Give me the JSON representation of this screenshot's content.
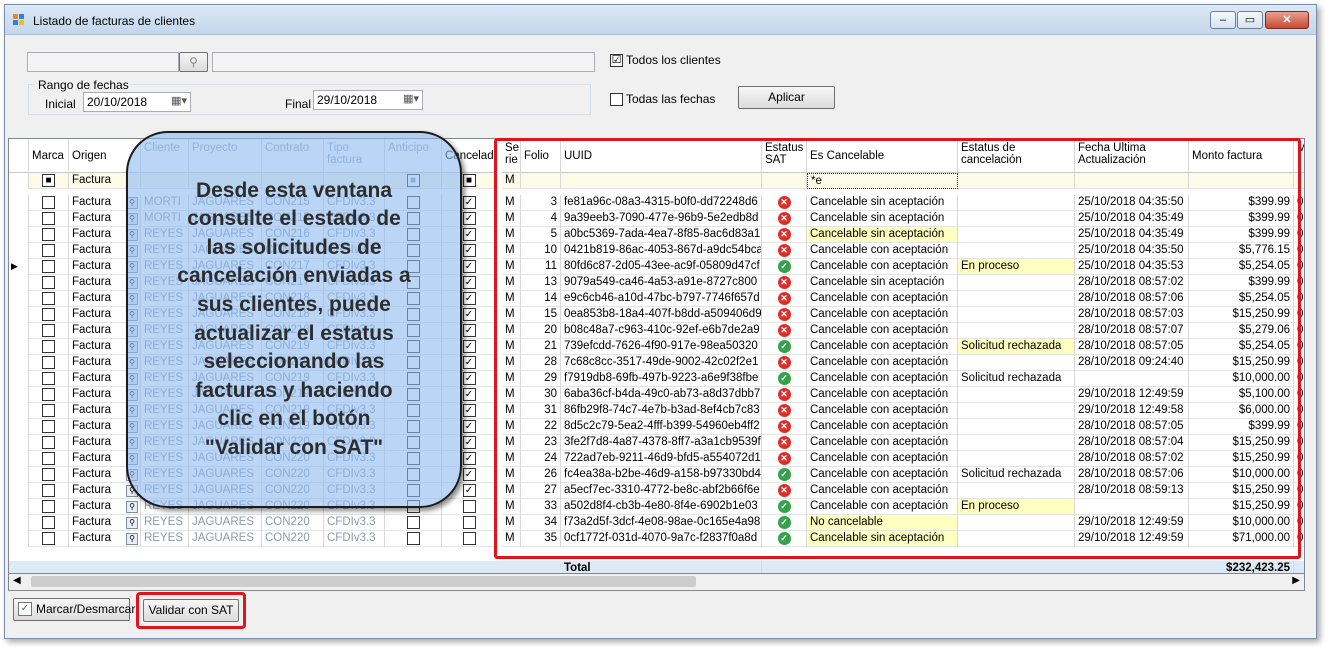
{
  "window": {
    "title": "Listado de facturas de clientes",
    "btn_min": "‒",
    "btn_max": "▭",
    "btn_close": "✕",
    "brand_colors": {
      "titlebar": "#c4d6ec",
      "red_highlight": "#e0141a",
      "callout": "#8cb9f0"
    }
  },
  "filters": {
    "client_code_value": "",
    "client_name_value": "",
    "lookup_icon": "binoculars-icon",
    "todos_clientes_label": "Todos los clientes",
    "todos_clientes_checked": "☑",
    "rango_label": "Rango de fechas",
    "inicial_label": "Inicial",
    "inicial_value": "20/10/2018",
    "final_label": "Final",
    "final_value": "29/10/2018",
    "calendar_icon": "calendar-icon",
    "todas_fechas_label": "Todas las fechas",
    "aplicar_label": "Aplicar"
  },
  "columns": {
    "marca": "Marca",
    "origen": "Origen",
    "cliente": "Cliente",
    "proyecto": "Proyecto",
    "contrato": "Contrato",
    "tipo": "Tipo\nfactura",
    "anticipo": "Anticipo",
    "cancelada": "Cancelada",
    "serie": "Se\nrie",
    "folio": "Folio",
    "uuid": "UUID",
    "estatus_sat": "Estatus\nSAT",
    "es_cancelable": "Es Cancelable",
    "estatus_cancelacion": "Estatus de\ncancelación",
    "fecha": "Fecha Ultima\nActualización",
    "monto": "Monto factura",
    "extra": "Mo"
  },
  "filter_row": {
    "marca": "■",
    "origen": "Factura",
    "anticipo": "■",
    "cancelada": "■",
    "serie": "M",
    "es_cancelable": "*e"
  },
  "rows": [
    {
      "origen": "Factura",
      "cliente": "MORTI",
      "proyecto": "JAGUARES",
      "contrato": "CON215",
      "tipo": "CFDIv3.3",
      "anticipo": "",
      "cancelada": "☑",
      "serie": "M",
      "folio": "3",
      "uuid": "fe81a96c-08a3-4315-b0f0-dd72248d6",
      "sat": "x",
      "es_cancelable": "Cancelable sin aceptación",
      "hl_cancelable": false,
      "estatus": "",
      "hl_estatus": false,
      "fecha": "25/10/2018 04:35:50",
      "monto": "$399.99"
    },
    {
      "origen": "Factura",
      "cliente": "MORTI",
      "proyecto": "JAGUARES",
      "contrato": "CON215",
      "tipo": "CFDIv3.3",
      "anticipo": "",
      "cancelada": "☑",
      "serie": "M",
      "folio": "4",
      "uuid": "9a39eeb3-7090-477e-96b9-5e2edb8d",
      "sat": "x",
      "es_cancelable": "Cancelable sin aceptación",
      "hl_cancelable": false,
      "estatus": "",
      "hl_estatus": false,
      "fecha": "25/10/2018 04:35:49",
      "monto": "$399.99"
    },
    {
      "origen": "Factura",
      "cliente": "REYES",
      "proyecto": "JAGUARES",
      "contrato": "CON216",
      "tipo": "CFDIv3.3",
      "anticipo": "",
      "cancelada": "☑",
      "serie": "M",
      "folio": "5",
      "uuid": "a0bc5369-7ada-4ea7-8f85-8ac6d83a1",
      "sat": "x",
      "es_cancelable": "Cancelable sin aceptación",
      "hl_cancelable": true,
      "estatus": "",
      "hl_estatus": false,
      "fecha": "25/10/2018 04:35:49",
      "monto": "$399.99"
    },
    {
      "origen": "Factura",
      "cliente": "REYES",
      "proyecto": "JAGUARES",
      "contrato": "CON216",
      "tipo": "CFDIv3.3",
      "anticipo": "",
      "cancelada": "☑",
      "serie": "M",
      "folio": "10",
      "uuid": "0421b819-86ac-4053-867d-a9dc54bca",
      "sat": "x",
      "es_cancelable": "Cancelable con aceptación",
      "hl_cancelable": false,
      "estatus": "",
      "hl_estatus": false,
      "fecha": "25/10/2018 04:35:50",
      "monto": "$5,776.15"
    },
    {
      "origen": "Factura",
      "cliente": "REYES",
      "proyecto": "JAGUARES",
      "contrato": "CON217",
      "tipo": "CFDIv3.3",
      "anticipo": "",
      "cancelada": "☑",
      "serie": "M",
      "folio": "11",
      "uuid": "80fd6c87-2d05-43ee-ac9f-05809d47cf",
      "sat": "ok",
      "es_cancelable": "Cancelable con aceptación",
      "hl_cancelable": false,
      "estatus": "En proceso",
      "hl_estatus": true,
      "fecha": "25/10/2018 04:35:53",
      "monto": "$5,254.05"
    },
    {
      "origen": "Factura",
      "cliente": "REYES",
      "proyecto": "JAGUARES",
      "contrato": "CON217",
      "tipo": "CFDIv3.3",
      "anticipo": "",
      "cancelada": "☑",
      "serie": "M",
      "folio": "13",
      "uuid": "9079a549-ca46-4a53-a91e-8727c800",
      "sat": "x",
      "es_cancelable": "Cancelable sin aceptación",
      "hl_cancelable": false,
      "estatus": "",
      "hl_estatus": false,
      "fecha": "28/10/2018 08:57:02",
      "monto": "$399.99"
    },
    {
      "origen": "Factura",
      "cliente": "REYES",
      "proyecto": "JAGUARES",
      "contrato": "CON218",
      "tipo": "CFDIv3.3",
      "anticipo": "",
      "cancelada": "☑",
      "serie": "M",
      "folio": "14",
      "uuid": "e9c6cb46-a10d-47bc-b797-7746f657d",
      "sat": "x",
      "es_cancelable": "Cancelable con aceptación",
      "hl_cancelable": false,
      "estatus": "",
      "hl_estatus": false,
      "fecha": "28/10/2018 08:57:06",
      "monto": "$5,254.05"
    },
    {
      "origen": "Factura",
      "cliente": "REYES",
      "proyecto": "JAGUARES",
      "contrato": "CON218",
      "tipo": "CFDIv3.3",
      "anticipo": "",
      "cancelada": "☑",
      "serie": "M",
      "folio": "15",
      "uuid": "0ea853b8-18a4-407f-b8dd-a509406d9",
      "sat": "x",
      "es_cancelable": "Cancelable con aceptación",
      "hl_cancelable": false,
      "estatus": "",
      "hl_estatus": false,
      "fecha": "28/10/2018 08:57:03",
      "monto": "$15,250.99"
    },
    {
      "origen": "Factura",
      "cliente": "REYES",
      "proyecto": "JAGUARES",
      "contrato": "CON218",
      "tipo": "CFDIv3.3",
      "anticipo": "",
      "cancelada": "☑",
      "serie": "M",
      "folio": "20",
      "uuid": "b08c48a7-c963-410c-92ef-e6b7de2a9",
      "sat": "x",
      "es_cancelable": "Cancelable con aceptación",
      "hl_cancelable": false,
      "estatus": "",
      "hl_estatus": false,
      "fecha": "28/10/2018 08:57:07",
      "monto": "$5,279.06"
    },
    {
      "origen": "Factura",
      "cliente": "REYES",
      "proyecto": "JAGUARES",
      "contrato": "CON219",
      "tipo": "CFDIv3.3",
      "anticipo": "",
      "cancelada": "☑",
      "serie": "M",
      "folio": "21",
      "uuid": "739efcdd-7626-4f90-917e-98ea50320",
      "sat": "ok",
      "es_cancelable": "Cancelable con aceptación",
      "hl_cancelable": false,
      "estatus": "Solicitud rechazada",
      "hl_estatus": true,
      "fecha": "28/10/2018 08:57:05",
      "monto": "$5,254.05"
    },
    {
      "origen": "Factura",
      "cliente": "REYES",
      "proyecto": "JAGUARES",
      "contrato": "CON219",
      "tipo": "CFDIv3.3",
      "anticipo": "",
      "cancelada": "☑",
      "serie": "M",
      "folio": "28",
      "uuid": "7c68c8cc-3517-49de-9002-42c02f2e1",
      "sat": "x",
      "es_cancelable": "Cancelable con aceptación",
      "hl_cancelable": false,
      "estatus": "",
      "hl_estatus": false,
      "fecha": "28/10/2018 09:24:40",
      "monto": "$15,250.99"
    },
    {
      "origen": "Factura",
      "cliente": "REYES",
      "proyecto": "JAGUARES",
      "contrato": "CON219",
      "tipo": "CFDIv3.3",
      "anticipo": "",
      "cancelada": "☑",
      "serie": "M",
      "folio": "29",
      "uuid": "f7919db8-69fb-497b-9223-a6e9f38fbe",
      "sat": "ok",
      "es_cancelable": "Cancelable con aceptación",
      "hl_cancelable": false,
      "estatus": "Solicitud rechazada",
      "hl_estatus": false,
      "fecha": "",
      "monto": "$10,000.00"
    },
    {
      "origen": "Factura",
      "cliente": "REYES",
      "proyecto": "JAGUARES",
      "contrato": "CON219",
      "tipo": "CFDIv3.3",
      "anticipo": "",
      "cancelada": "☑",
      "serie": "M",
      "folio": "30",
      "uuid": "6aba36cf-b4da-49c0-ab73-a8d37dbb7",
      "sat": "x",
      "es_cancelable": "Cancelable con aceptación",
      "hl_cancelable": false,
      "estatus": "",
      "hl_estatus": false,
      "fecha": "29/10/2018 12:49:59",
      "monto": "$5,100.00"
    },
    {
      "origen": "Factura",
      "cliente": "REYES",
      "proyecto": "JAGUARES",
      "contrato": "CON219",
      "tipo": "CFDIv3.3",
      "anticipo": "",
      "cancelada": "☑",
      "serie": "M",
      "folio": "31",
      "uuid": "86fb29f8-74c7-4e7b-b3ad-8ef4cb7c83",
      "sat": "x",
      "es_cancelable": "Cancelable con aceptación",
      "hl_cancelable": false,
      "estatus": "",
      "hl_estatus": false,
      "fecha": "29/10/2018 12:49:58",
      "monto": "$6,000.00"
    },
    {
      "origen": "Factura",
      "cliente": "REYES",
      "proyecto": "JAGUARES",
      "contrato": "CON219",
      "tipo": "CFDIv3.3",
      "anticipo": "",
      "cancelada": "☑",
      "serie": "M",
      "folio": "22",
      "uuid": "8d5c2c79-5ea2-4fff-b399-54960eb4ff2",
      "sat": "x",
      "es_cancelable": "Cancelable con aceptación",
      "hl_cancelable": false,
      "estatus": "",
      "hl_estatus": false,
      "fecha": "28/10/2018 08:57:05",
      "monto": "$399.99"
    },
    {
      "origen": "Factura",
      "cliente": "REYES",
      "proyecto": "JAGUARES",
      "contrato": "CON220",
      "tipo": "CFDIv3.3",
      "anticipo": "",
      "cancelada": "☑",
      "serie": "M",
      "folio": "23",
      "uuid": "3fe2f7d8-4a87-4378-8ff7-a3a1cb9539f",
      "sat": "x",
      "es_cancelable": "Cancelable con aceptación",
      "hl_cancelable": false,
      "estatus": "",
      "hl_estatus": false,
      "fecha": "28/10/2018 08:57:04",
      "monto": "$15,250.99"
    },
    {
      "origen": "Factura",
      "cliente": "REYES",
      "proyecto": "JAGUARES",
      "contrato": "CON220",
      "tipo": "CFDIv3.3",
      "anticipo": "",
      "cancelada": "☑",
      "serie": "M",
      "folio": "24",
      "uuid": "722ad7eb-9211-46d9-bfd5-a554072d1",
      "sat": "x",
      "es_cancelable": "Cancelable con aceptación",
      "hl_cancelable": false,
      "estatus": "",
      "hl_estatus": false,
      "fecha": "28/10/2018 08:57:02",
      "monto": "$15,250.99"
    },
    {
      "origen": "Factura",
      "cliente": "REYES",
      "proyecto": "JAGUARES",
      "contrato": "CON220",
      "tipo": "CFDIv3.3",
      "anticipo": "",
      "cancelada": "☑",
      "serie": "M",
      "folio": "26",
      "uuid": "fc4ea38a-b2be-46d9-a158-b97330bd4",
      "sat": "ok",
      "es_cancelable": "Cancelable con aceptación",
      "hl_cancelable": false,
      "estatus": "Solicitud rechazada",
      "hl_estatus": false,
      "fecha": "28/10/2018 08:57:06",
      "monto": "$10,000.00"
    },
    {
      "origen": "Factura",
      "cliente": "REYES",
      "proyecto": "JAGUARES",
      "contrato": "CON220",
      "tipo": "CFDIv3.3",
      "anticipo": "",
      "cancelada": "☑",
      "serie": "M",
      "folio": "27",
      "uuid": "a5ecf7ec-3310-4772-be8c-abf2b66f6e",
      "sat": "x",
      "es_cancelable": "Cancelable con aceptación",
      "hl_cancelable": false,
      "estatus": "",
      "hl_estatus": false,
      "fecha": "28/10/2018 08:59:13",
      "monto": "$15,250.99"
    },
    {
      "origen": "Factura",
      "cliente": "REYES",
      "proyecto": "JAGUARES",
      "contrato": "CON220",
      "tipo": "CFDIv3.3",
      "anticipo": "",
      "cancelada": "☐",
      "serie": "M",
      "folio": "33",
      "uuid": "a502d8f4-cb3b-4e80-8f4e-6902b1e03",
      "sat": "ok",
      "es_cancelable": "Cancelable con aceptación",
      "hl_cancelable": false,
      "estatus": "En proceso",
      "hl_estatus": true,
      "fecha": "",
      "monto": "$15,250.99"
    },
    {
      "origen": "Factura",
      "cliente": "REYES",
      "proyecto": "JAGUARES",
      "contrato": "CON220",
      "tipo": "CFDIv3.3",
      "anticipo": "",
      "cancelada": "☐",
      "serie": "M",
      "folio": "34",
      "uuid": "f73a2d5f-3dcf-4e08-98ae-0c165e4a98",
      "sat": "ok",
      "es_cancelable": "No cancelable",
      "hl_cancelable": true,
      "estatus": "",
      "hl_estatus": false,
      "fecha": "29/10/2018 12:49:59",
      "monto": "$10,000.00"
    },
    {
      "origen": "Factura",
      "cliente": "REYES",
      "proyecto": "JAGUARES",
      "contrato": "CON220",
      "tipo": "CFDIv3.3",
      "anticipo": "",
      "cancelada": "☐",
      "serie": "M",
      "folio": "35",
      "uuid": "0cf1772f-031d-4070-9a7c-f2837f0a8d",
      "sat": "ok",
      "es_cancelable": "Cancelable sin aceptación",
      "hl_cancelable": true,
      "estatus": "",
      "hl_estatus": false,
      "fecha": "29/10/2018 12:49:59",
      "monto": "$71,000.00"
    }
  ],
  "totals": {
    "label": "Total",
    "monto": "$232,423.25"
  },
  "callout_text": "Desde esta ventana\nconsulte el estado de\nlas solicitudes de\ncancelación enviadas a\nsus clientes, puede\nactualizar el estatus\nseleccionando las\nfacturas y haciendo\nclic en el botón\n\"Validar con SAT\"",
  "footer": {
    "marcar_label": "Marcar/Desmarcar",
    "marcar_icon": "checklist-icon",
    "validar_label": "Validar con SAT"
  }
}
